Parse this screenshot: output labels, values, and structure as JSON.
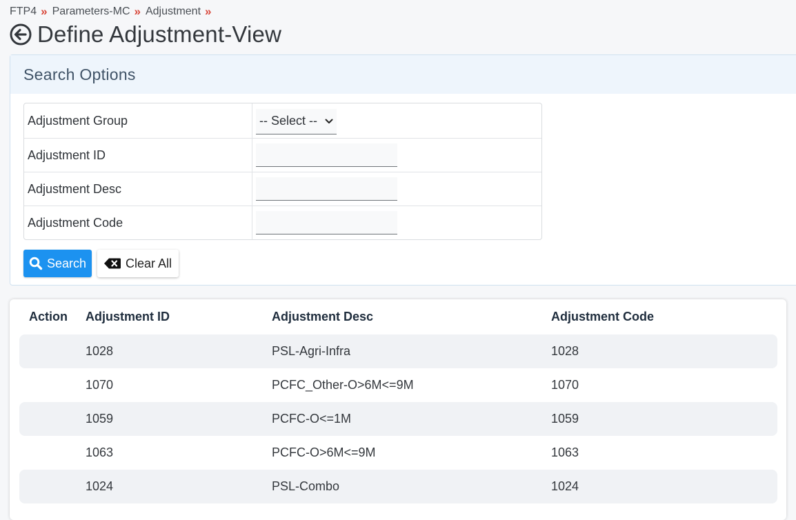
{
  "breadcrumb": {
    "items": [
      "FTP4",
      "Parameters-MC",
      "Adjustment"
    ],
    "separator": "»"
  },
  "page": {
    "title": "Define Adjustment-View"
  },
  "search": {
    "header": "Search Options",
    "fields": {
      "group_label": "Adjustment Group",
      "group_selected": "-- Select --",
      "id_label": "Adjustment ID",
      "id_value": "",
      "desc_label": "Adjustment Desc",
      "desc_value": "",
      "code_label": "Adjustment Code",
      "code_value": ""
    },
    "search_button": "Search",
    "clear_button": "Clear All"
  },
  "results": {
    "columns": [
      "Action",
      "Adjustment ID",
      "Adjustment Desc",
      "Adjustment Code"
    ],
    "rows": [
      {
        "action": "",
        "id": "1028",
        "desc": "PSL-Agri-Infra",
        "code": "1028"
      },
      {
        "action": "",
        "id": "1070",
        "desc": "PCFC_Other-O>6M<=9M",
        "code": "1070"
      },
      {
        "action": "",
        "id": "1059",
        "desc": "PCFC-O<=1M",
        "code": "1059"
      },
      {
        "action": "",
        "id": "1063",
        "desc": "PCFC-O>6M<=9M",
        "code": "1063"
      },
      {
        "action": "",
        "id": "1024",
        "desc": "PSL-Combo",
        "code": "1024"
      }
    ]
  },
  "colors": {
    "accent": "#1c92f0",
    "breadcrumb_separator": "#d8473a",
    "panel_header_bg": "#eef5fc",
    "row_stripe": "#f0f2f5"
  },
  "icons": {
    "back": "arrow-left-circle-icon",
    "search": "magnifier-icon",
    "clear": "backspace-x-icon",
    "dropdown": "chevron-down-icon"
  }
}
